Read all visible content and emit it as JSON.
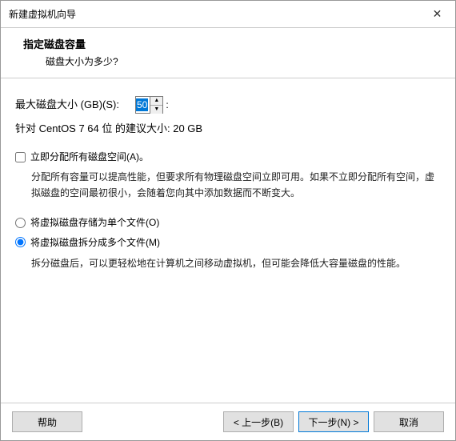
{
  "window": {
    "title": "新建虚拟机向导"
  },
  "header": {
    "title": "指定磁盘容量",
    "subtitle": "磁盘大小为多少?"
  },
  "disk": {
    "size_label": "最大磁盘大小 (GB)(S):",
    "size_value": "50",
    "recommend": "针对 CentOS 7 64 位 的建议大小: 20 GB"
  },
  "allocate": {
    "label": "立即分配所有磁盘空间(A)。",
    "hint": "分配所有容量可以提高性能，但要求所有物理磁盘空间立即可用。如果不立即分配所有空间，虚拟磁盘的空间最初很小，会随着您向其中添加数据而不断变大。"
  },
  "store": {
    "single_label": "将虚拟磁盘存储为单个文件(O)",
    "split_label": "将虚拟磁盘拆分成多个文件(M)",
    "split_hint": "拆分磁盘后，可以更轻松地在计算机之间移动虚拟机，但可能会降低大容量磁盘的性能。"
  },
  "buttons": {
    "help": "帮助",
    "back": "< 上一步(B)",
    "next": "下一步(N) >",
    "cancel": "取消"
  }
}
